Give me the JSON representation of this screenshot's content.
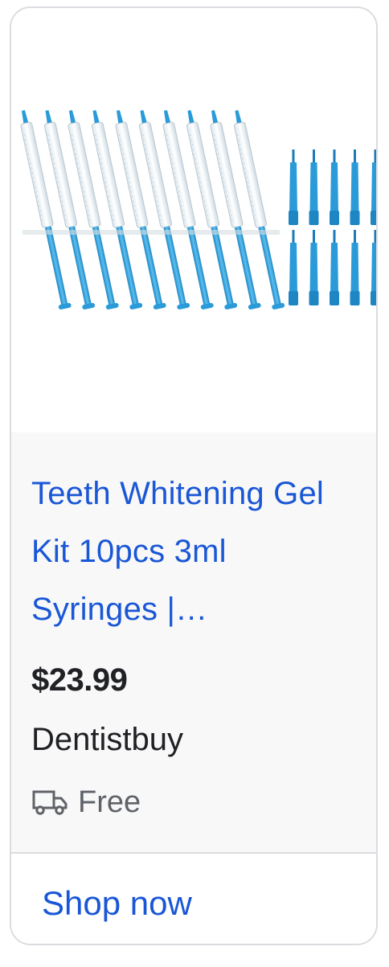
{
  "product": {
    "title": "Teeth Whitening Gel Kit 10pcs 3ml Syringes |…",
    "price": "$23.99",
    "merchant": "Dentistbuy",
    "shipping": "Free",
    "cta_label": "Shop now"
  },
  "icons": {
    "shipping": "truck-icon"
  },
  "colors": {
    "link": "#1a57d6",
    "text": "#202124",
    "muted": "#5f6368",
    "syringe_blue": "#2a9bd8",
    "info_bg": "#f8f8f8"
  }
}
